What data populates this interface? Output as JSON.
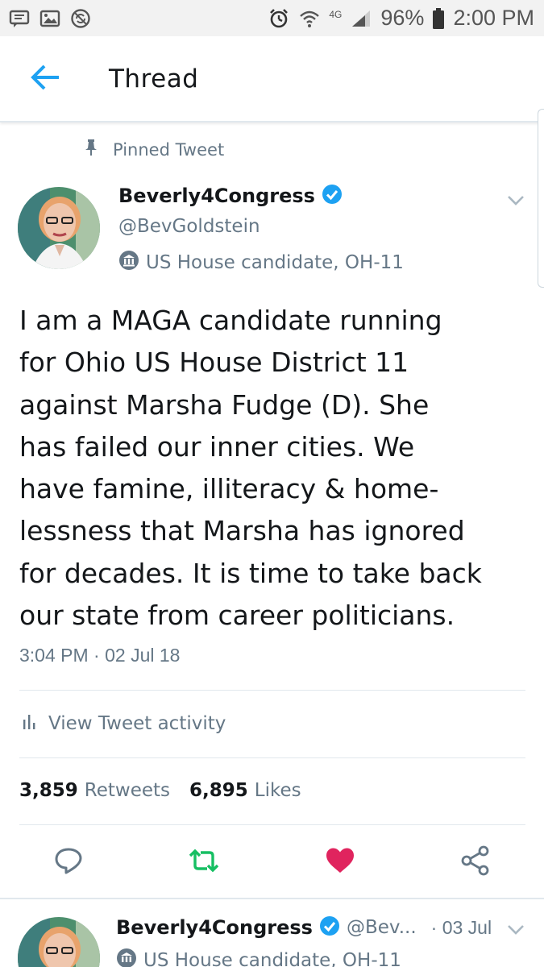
{
  "status_bar": {
    "left_icons": [
      "message-icon",
      "image-icon",
      "sync-icon"
    ],
    "right_icons": [
      "alarm-icon",
      "wifi-icon",
      "signal-icon",
      "battery-icon"
    ],
    "network": "4G",
    "battery": "96%",
    "time": "2:00 PM"
  },
  "header": {
    "title": "Thread",
    "back_icon": "arrow-left-icon"
  },
  "pinned": {
    "label": "Pinned Tweet",
    "icon": "pin-icon"
  },
  "tweet": {
    "display_name": "Beverly4Congress",
    "verified_icon": "verified-badge-icon",
    "handle": "@BevGoldstein",
    "label": "US House candidate, OH-11",
    "label_icon": "government-icon",
    "text_lines": [
      "I am a MAGA candidate running",
      "for Ohio US House District 11",
      "against Marsha Fudge (D). She",
      "has failed our inner cities. We",
      "have famine, illiteracy & home-",
      "lessness that Marsha has ignored",
      "for decades. It is time to take back",
      "our state from career politicians."
    ],
    "timestamp": "3:04 PM · 02 Jul 18",
    "activity_label": "View Tweet activity",
    "retweets_count": "3,859",
    "retweets_label": "Retweets",
    "likes_count": "6,895",
    "likes_label": "Likes"
  },
  "actions": [
    "reply-icon",
    "retweet-icon",
    "like-icon",
    "share-icon"
  ],
  "colors": {
    "accent": "#1da1f2",
    "retweet": "#17bf63",
    "like": "#e0245e",
    "muted": "#657786"
  },
  "next_tweet": {
    "display_name": "Beverly4Congress",
    "handle": "@Bev...",
    "date": "· 03 Jul",
    "label": "US House candidate, OH-11"
  }
}
